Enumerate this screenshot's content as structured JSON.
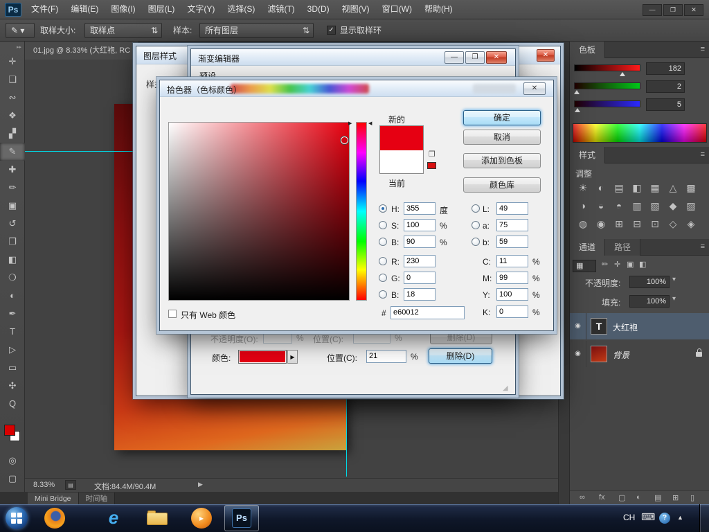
{
  "app": {
    "logo": "Ps"
  },
  "window": {
    "window_buttons": {
      "minimize": "—",
      "maximize": "❐",
      "close": "✕"
    }
  },
  "menubar": {
    "items": [
      "文件(F)",
      "编辑(E)",
      "图像(I)",
      "图层(L)",
      "文字(Y)",
      "选择(S)",
      "滤镜(T)",
      "3D(D)",
      "视图(V)",
      "窗口(W)",
      "帮助(H)"
    ]
  },
  "options_bar": {
    "sample_size_label": "取样大小:",
    "sample_size_value": "取样点",
    "sample_label": "样本:",
    "sample_value": "所有图层",
    "show_ring_label": "显示取样环"
  },
  "toolbar": {
    "glyphs": [
      "✛",
      "❏",
      "∾",
      "❖",
      "▞",
      "✎",
      "✚",
      "✏",
      "▣",
      "↺",
      "❒",
      "◧",
      "❍",
      "◐",
      "✒",
      "T",
      "▷",
      "▭",
      "✣",
      "Q"
    ]
  },
  "document": {
    "tab_title": "01.jpg @ 8.33% (大红袍, RC",
    "zoom": "8.33%",
    "info": "文档:84.4M/90.4M"
  },
  "bottom_tabs": {
    "mini_bridge": "Mini Bridge",
    "timeline": "时间轴"
  },
  "layer_style_dialog": {
    "title": "图层样式",
    "styles_label": "样式"
  },
  "gradient_editor": {
    "title": "渐变编辑器",
    "presets_label": "预设",
    "opacity_row": {
      "opacity_label": "不透明度(O):",
      "percent": "%",
      "position_label": "位置(C):",
      "delete_label": "删除(D)"
    },
    "color_row": {
      "color_label": "颜色:",
      "position_label": "位置(C):",
      "position_value": "21",
      "percent": "%",
      "delete_label": "删除(D)",
      "swatch_color": "#e60012"
    }
  },
  "color_picker": {
    "title": "拾色器（色标颜色）",
    "new_label": "新的",
    "current_label": "当前",
    "ok": "确定",
    "cancel": "取消",
    "add_to_swatches": "添加到色板",
    "color_libraries": "颜色库",
    "hsb": [
      {
        "label": "H:",
        "value": "355",
        "unit": "度"
      },
      {
        "label": "S:",
        "value": "100",
        "unit": "%"
      },
      {
        "label": "B:",
        "value": "90",
        "unit": "%"
      }
    ],
    "rgb": [
      {
        "label": "R:",
        "value": "230"
      },
      {
        "label": "G:",
        "value": "0"
      },
      {
        "label": "B:",
        "value": "18"
      }
    ],
    "lab": [
      {
        "label": "L:",
        "value": "49"
      },
      {
        "label": "a:",
        "value": "75"
      },
      {
        "label": "b:",
        "value": "59"
      }
    ],
    "cmyk": [
      {
        "label": "C:",
        "value": "11"
      },
      {
        "label": "M:",
        "value": "99"
      },
      {
        "label": "Y:",
        "value": "100"
      },
      {
        "label": "K:",
        "value": "0"
      }
    ],
    "percent": "%",
    "hex_label": "#",
    "hex_value": "e60012",
    "web_only_label": "只有 Web 颜色",
    "picked_color": "#e60012"
  },
  "panels": {
    "swatches": {
      "tab": "色板",
      "values": [
        "182",
        "2",
        "5"
      ]
    },
    "styles": {
      "tab": "样式"
    },
    "adjustments": {
      "label": "调整",
      "icons": [
        "☀",
        "◐",
        "▤",
        "◧",
        "▦",
        "△",
        "▩",
        "◑",
        "◒",
        "◓",
        "▥",
        "▧",
        "◆",
        "▨",
        "◍",
        "◉",
        "⊞",
        "⊟",
        "⊡",
        "◇",
        "◈"
      ]
    },
    "channels_tab": "通道",
    "paths_tab": "路径",
    "layers": {
      "opacity_label": "不透明度:",
      "opacity_value": "100%",
      "fill_label": "填充:",
      "fill_value": "100%",
      "lock_icons": [
        "✏",
        "✛",
        "▣",
        "◧"
      ],
      "text_layer_name": "大红袍",
      "text_layer_thumb": "T",
      "background_layer_name": "背景",
      "bottom_icons": [
        "∞",
        "fx",
        "▢",
        "◐",
        "▤",
        "⊞",
        "▯"
      ]
    }
  },
  "taskbar": {
    "tray_lang": "CH"
  },
  "icons": {
    "check": "✓",
    "updown": "⇅",
    "dropdown": "▾",
    "panel_menu": "≡",
    "eye": "◉",
    "gamut_cube": "❒",
    "swatch_arrow": "▶",
    "hue_left": "▶",
    "hue_right": "◀",
    "status_arrow": "▶",
    "status_box": "▤",
    "resize": "◢",
    "grid_box": "▦",
    "tray_keyboard": "⌨",
    "tray_up": "▲",
    "tray_help": "?",
    "ie_glyph": "e",
    "media_play": "▸"
  }
}
